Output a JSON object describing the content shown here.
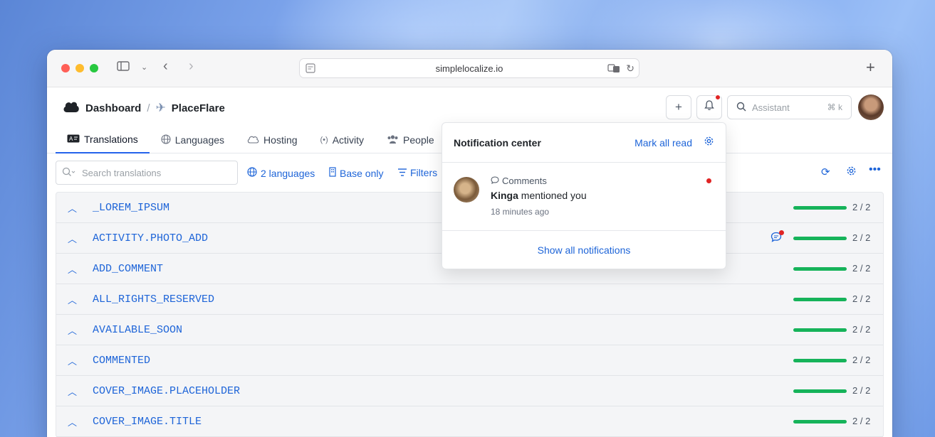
{
  "browser": {
    "url": "simplelocalize.io"
  },
  "header": {
    "breadcrumb_root": "Dashboard",
    "breadcrumb_project": "PlaceFlare",
    "assistant_placeholder": "Assistant",
    "assistant_shortcut": "⌘ k",
    "add_button_label": "+"
  },
  "tabs": [
    {
      "label": "Translations",
      "icon": "translations-icon"
    },
    {
      "label": "Languages",
      "icon": "globe-icon"
    },
    {
      "label": "Hosting",
      "icon": "cloud-icon"
    },
    {
      "label": "Activity",
      "icon": "activity-icon"
    },
    {
      "label": "People",
      "icon": "people-icon"
    }
  ],
  "toolbar": {
    "search_placeholder": "Search translations",
    "languages_filter": "2 languages",
    "base_only": "Base only",
    "filters": "Filters"
  },
  "rows": [
    {
      "key": "_LOREM_IPSUM",
      "progress": "2 / 2",
      "has_comment": false
    },
    {
      "key": "ACTIVITY.PHOTO_ADD",
      "progress": "2 / 2",
      "has_comment": true
    },
    {
      "key": "ADD_COMMENT",
      "progress": "2 / 2",
      "has_comment": false
    },
    {
      "key": "ALL_RIGHTS_RESERVED",
      "progress": "2 / 2",
      "has_comment": false
    },
    {
      "key": "AVAILABLE_SOON",
      "progress": "2 / 2",
      "has_comment": false
    },
    {
      "key": "COMMENTED",
      "progress": "2 / 2",
      "has_comment": false
    },
    {
      "key": "COVER_IMAGE.PLACEHOLDER",
      "progress": "2 / 2",
      "has_comment": false
    },
    {
      "key": "COVER_IMAGE.TITLE",
      "progress": "2 / 2",
      "has_comment": false
    }
  ],
  "notifications": {
    "title": "Notification center",
    "mark_all_read": "Mark all read",
    "item": {
      "category": "Comments",
      "user": "Kinga",
      "message": "mentioned you",
      "time": "18 minutes ago"
    },
    "show_all": "Show all notifications"
  },
  "colors": {
    "accent": "#1d64d8",
    "progress": "#16b35a",
    "unread_dot": "#e02424"
  }
}
